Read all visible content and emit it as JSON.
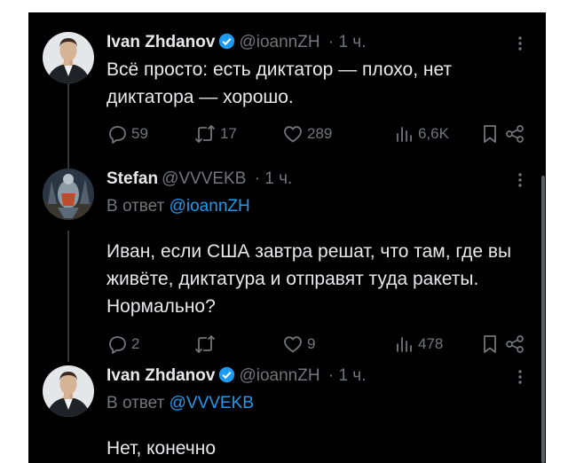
{
  "colors": {
    "background": "#000000",
    "text": "#e7e9ea",
    "secondary": "#71767b",
    "accent": "#1d9bf0"
  },
  "tweets": [
    {
      "author": "Ivan Zhdanov",
      "verified": true,
      "handle": "@ioannZH",
      "time": "· 1 ч.",
      "reply_prefix": "",
      "reply_to": "",
      "text": "Всё просто: есть диктатор — плохо, нет диктатора — хорошо.",
      "replies": "59",
      "retweets": "17",
      "likes": "289",
      "views": "6,6K"
    },
    {
      "author": "Stefan",
      "verified": false,
      "handle": "@VVVEKB",
      "time": "· 1 ч.",
      "reply_prefix": "В ответ",
      "reply_to": "@ioannZH",
      "text": "Иван, если США завтра решат, что там, где вы живёте, диктатура и отправят туда ракеты. Нормально?",
      "replies": "2",
      "retweets": "",
      "likes": "9",
      "views": "478"
    },
    {
      "author": "Ivan Zhdanov",
      "verified": true,
      "handle": "@ioannZH",
      "time": "· 1 ч.",
      "reply_prefix": "В ответ",
      "reply_to": "@VVVEKB",
      "text": "Нет, конечно"
    }
  ]
}
